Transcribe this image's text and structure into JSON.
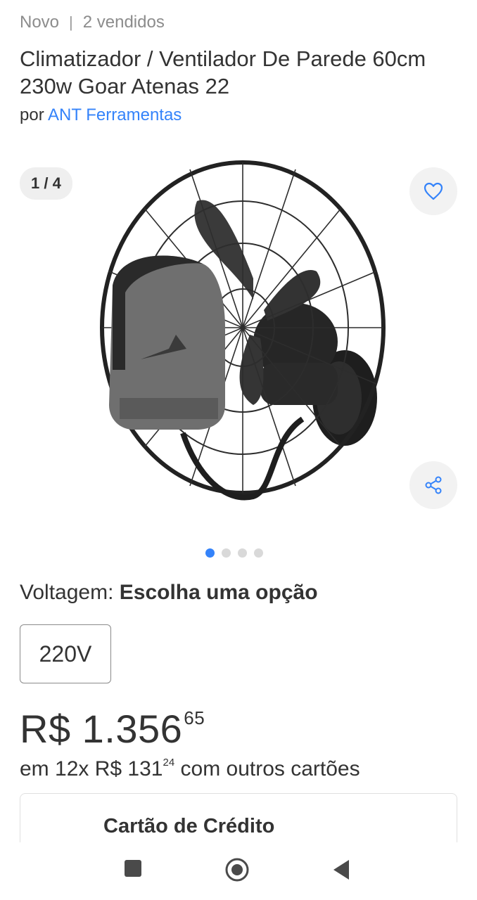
{
  "listing": {
    "condition": "Novo",
    "separator": "|",
    "sold": "2 vendidos",
    "title": "Climatizador / Ventilador De Parede 60cm 230w Goar Atenas 22",
    "seller_prefix": "por",
    "seller_name": "ANT Ferramentas"
  },
  "gallery": {
    "counter": "1 / 4",
    "dots": 4,
    "active_dot": 1,
    "favorite_icon": "heart-icon",
    "share_icon": "share-icon"
  },
  "variant": {
    "label": "Voltagem:",
    "value": "Escolha uma opção",
    "options": [
      "220V"
    ]
  },
  "pricing": {
    "currency": "R$",
    "amount": "1.356",
    "cents": "65",
    "installment_prefix": "em 12x R$",
    "installment_amount": "131",
    "installment_cents": "24",
    "installment_suffix": "com outros cartões"
  },
  "payment_card": {
    "title": "Cartão de Crédito"
  },
  "navbar": {
    "icons": [
      "recents-square-icon",
      "home-circle-icon",
      "back-triangle-icon"
    ]
  },
  "colors": {
    "accent": "#3483fa",
    "text": "#333333",
    "muted": "#8c8c8c"
  }
}
